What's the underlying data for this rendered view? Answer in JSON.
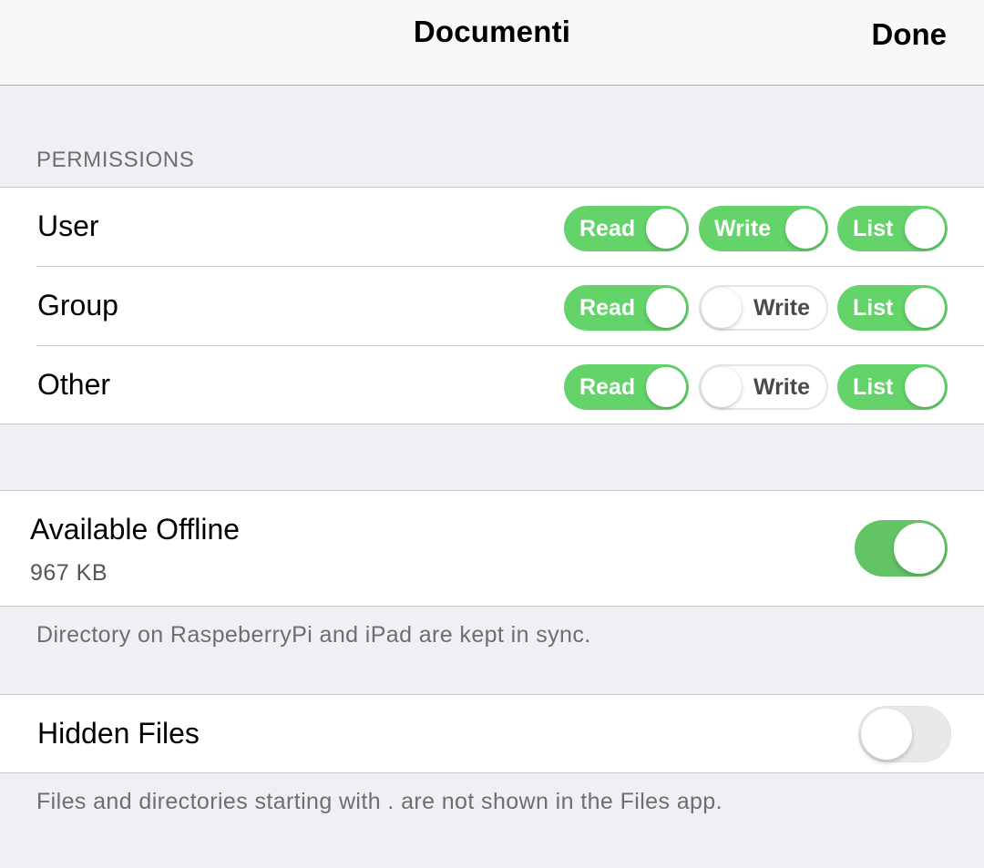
{
  "navbar": {
    "title": "Documenti",
    "done_label": "Done"
  },
  "permissions": {
    "header": "PERMISSIONS",
    "rows": [
      {
        "label": "User",
        "read": {
          "label": "Read",
          "on": true
        },
        "write": {
          "label": "Write",
          "on": true
        },
        "list": {
          "label": "List",
          "on": true
        }
      },
      {
        "label": "Group",
        "read": {
          "label": "Read",
          "on": true
        },
        "write": {
          "label": "Write",
          "on": false
        },
        "list": {
          "label": "List",
          "on": true
        }
      },
      {
        "label": "Other",
        "read": {
          "label": "Read",
          "on": true
        },
        "write": {
          "label": "Write",
          "on": false
        },
        "list": {
          "label": "List",
          "on": true
        }
      }
    ]
  },
  "offline": {
    "title": "Available Offline",
    "size": "967 KB",
    "on": true,
    "footer": "Directory on RaspeberryPi and iPad are kept in sync."
  },
  "hidden_files": {
    "title": "Hidden Files",
    "on": false,
    "footer": "Files and directories starting with . are not shown in the Files app."
  },
  "colors": {
    "switch_on": "#63c465",
    "pill_on": "#63d36a",
    "group_background": "#efeff4",
    "secondary_text": "#6d6d72"
  }
}
